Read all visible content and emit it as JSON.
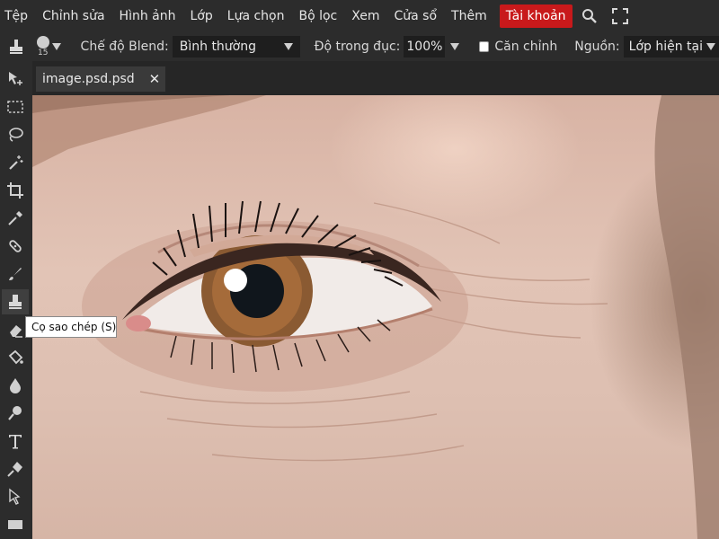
{
  "menu": {
    "items": [
      "Tệp",
      "Chỉnh sửa",
      "Hình ảnh",
      "Lớp",
      "Lựa chọn",
      "Bộ lọc",
      "Xem",
      "Cửa sổ",
      "Thêm"
    ],
    "account_label": "Tài khoản",
    "icons": [
      "search-icon",
      "fullscreen-icon"
    ],
    "account_color": "#c8191b"
  },
  "options": {
    "brush_size": "15",
    "blend_label": "Chế độ Blend:",
    "blend_value": "Bình thường",
    "opacity_label": "Độ trong đục:",
    "opacity_value": "100%",
    "align_label": "Căn chỉnh",
    "align_checked": false,
    "source_label": "Nguồn:",
    "source_value": "Lớp hiện tại"
  },
  "tab": {
    "title": "image.psd.psd"
  },
  "tools": {
    "items": [
      "move",
      "marquee",
      "lasso",
      "magic-wand",
      "crop",
      "eyedropper",
      "spot-healing",
      "brush",
      "clone-stamp",
      "eraser",
      "paint-bucket",
      "blur",
      "dodge",
      "text",
      "pen",
      "path-select",
      "rectangle"
    ],
    "active": "clone-stamp",
    "tooltip": "Cọ sao chép (S)"
  }
}
